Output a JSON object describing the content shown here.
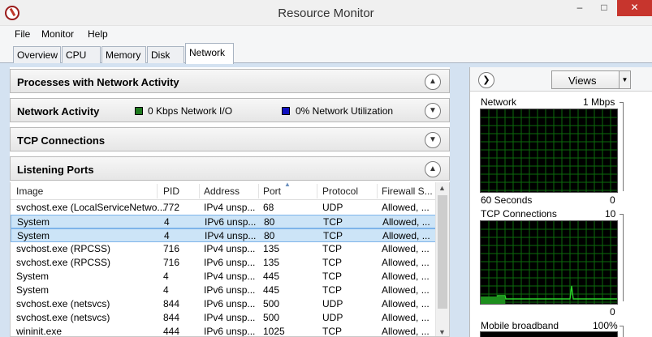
{
  "window": {
    "title": "Resource Monitor",
    "minimize": "–",
    "maximize": "□",
    "close": "✕"
  },
  "menu": [
    "File",
    "Monitor",
    "Help"
  ],
  "tabs": [
    "Overview",
    "CPU",
    "Memory",
    "Disk",
    "Network"
  ],
  "active_tab": "Network",
  "panels": {
    "processes": "Processes with Network Activity",
    "activity": "Network Activity",
    "activity_io": "0 Kbps Network I/O",
    "activity_util": "0% Network Utilization",
    "tcp": "TCP Connections",
    "listening": "Listening Ports"
  },
  "colors": {
    "io_legend": "#1f7a1f",
    "util_legend": "#1010c0",
    "graph_grid": "#0c6b0c",
    "graph_line": "#2ad12a"
  },
  "table": {
    "columns": [
      "Image",
      "PID",
      "Address",
      "Port",
      "Protocol",
      "Firewall S..."
    ],
    "rows": [
      [
        "svchost.exe (LocalServiceNetwo...",
        "772",
        "IPv4 unsp...",
        "68",
        "UDP",
        "Allowed, ..."
      ],
      [
        "System",
        "4",
        "IPv6 unsp...",
        "80",
        "TCP",
        "Allowed, ..."
      ],
      [
        "System",
        "4",
        "IPv4 unsp...",
        "80",
        "TCP",
        "Allowed, ..."
      ],
      [
        "svchost.exe (RPCSS)",
        "716",
        "IPv4 unsp...",
        "135",
        "TCP",
        "Allowed, ..."
      ],
      [
        "svchost.exe (RPCSS)",
        "716",
        "IPv6 unsp...",
        "135",
        "TCP",
        "Allowed, ..."
      ],
      [
        "System",
        "4",
        "IPv4 unsp...",
        "445",
        "TCP",
        "Allowed, ..."
      ],
      [
        "System",
        "4",
        "IPv6 unsp...",
        "445",
        "TCP",
        "Allowed, ..."
      ],
      [
        "svchost.exe (netsvcs)",
        "844",
        "IPv6 unsp...",
        "500",
        "UDP",
        "Allowed, ..."
      ],
      [
        "svchost.exe (netsvcs)",
        "844",
        "IPv4 unsp...",
        "500",
        "UDP",
        "Allowed, ..."
      ],
      [
        "wininit.exe",
        "444",
        "IPv6 unsp...",
        "1025",
        "TCP",
        "Allowed, ..."
      ]
    ],
    "selected_rows": [
      1,
      2
    ]
  },
  "right": {
    "views_label": "Views",
    "graphs": {
      "network": {
        "label": "Network",
        "max": "1 Mbps",
        "time": "60 Seconds",
        "min": "0"
      },
      "tcp": {
        "label": "TCP Connections",
        "max": "10",
        "min": "0"
      },
      "mobile": {
        "label": "Mobile broadband",
        "max": "100%"
      }
    }
  }
}
